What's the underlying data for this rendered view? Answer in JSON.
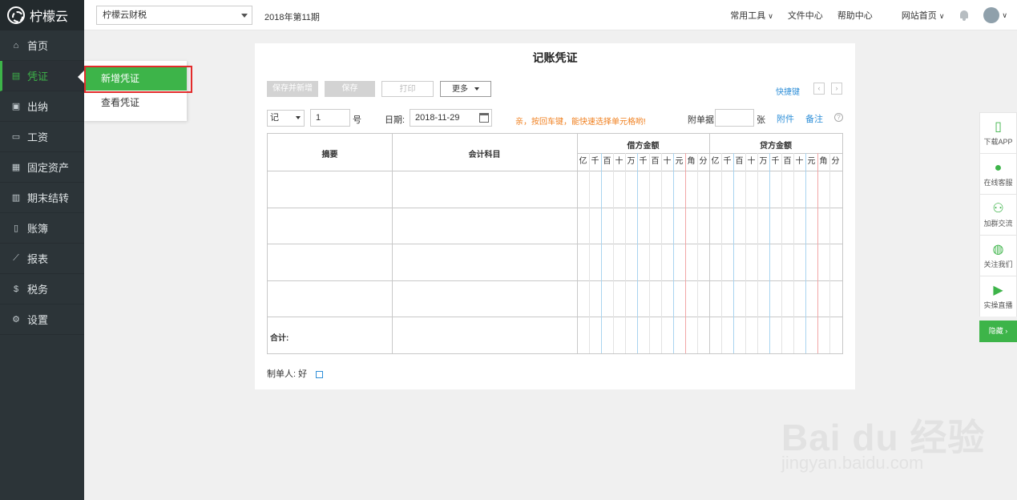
{
  "brand": {
    "name": "柠檬云"
  },
  "sidebar": {
    "items": [
      {
        "label": "首页",
        "icon": "home-icon",
        "glyph": "⌂"
      },
      {
        "label": "凭证",
        "icon": "voucher-icon",
        "glyph": "▤",
        "active": true
      },
      {
        "label": "出纳",
        "icon": "cashier-icon",
        "glyph": "▣"
      },
      {
        "label": "工资",
        "icon": "salary-card-icon",
        "glyph": "▭"
      },
      {
        "label": "固定资产",
        "icon": "asset-icon",
        "glyph": "▦"
      },
      {
        "label": "期末结转",
        "icon": "calendar-icon",
        "glyph": "▥"
      },
      {
        "label": "账簿",
        "icon": "book-icon",
        "glyph": "▯"
      },
      {
        "label": "报表",
        "icon": "chart-icon",
        "glyph": "⟋"
      },
      {
        "label": "税务",
        "icon": "tax-icon",
        "glyph": "$"
      },
      {
        "label": "设置",
        "icon": "gear-icon",
        "glyph": "⚙"
      }
    ]
  },
  "flyout": {
    "new_voucher": "新增凭证",
    "view_voucher": "查看凭证"
  },
  "topbar": {
    "company": "柠檬云财税",
    "period": "2018年第11期",
    "links": {
      "tools": "常用工具",
      "files": "文件中心",
      "help": "帮助中心",
      "site": "网站首页"
    }
  },
  "voucher": {
    "title": "记账凭证",
    "buttons": {
      "save_new": "保存并新增",
      "save": "保存",
      "print": "打印",
      "more": "更多"
    },
    "shortcut": "快捷键",
    "type": "记",
    "number": "1",
    "number_suffix": "号",
    "date_label": "日期:",
    "date": "2018-11-29",
    "tip": "亲，按回车键，能快速选择单元格哟!",
    "attachments_label": "附单据",
    "attachments_unit": "张",
    "attachment_link": "附件",
    "note_link": "备注",
    "help": "?",
    "table": {
      "summary": "摘要",
      "account": "会计科目",
      "debit": "借方金额",
      "credit": "贷方金额",
      "digits": [
        "亿",
        "千",
        "百",
        "十",
        "万",
        "千",
        "百",
        "十",
        "元",
        "角",
        "分"
      ],
      "total": "合计:"
    },
    "maker_label": "制单人:",
    "maker": "好"
  },
  "right_panel": {
    "items": [
      {
        "label": "下载APP",
        "glyph": "▯"
      },
      {
        "label": "在线客服",
        "glyph": "●"
      },
      {
        "label": "加群交流",
        "glyph": "⚇"
      },
      {
        "label": "关注我们",
        "glyph": "◍"
      },
      {
        "label": "实操直播",
        "glyph": "▶"
      }
    ],
    "hide": "隐藏 ›"
  },
  "watermark": {
    "main": "Bai du 经验",
    "sub": "jingyan.baidu.com"
  }
}
